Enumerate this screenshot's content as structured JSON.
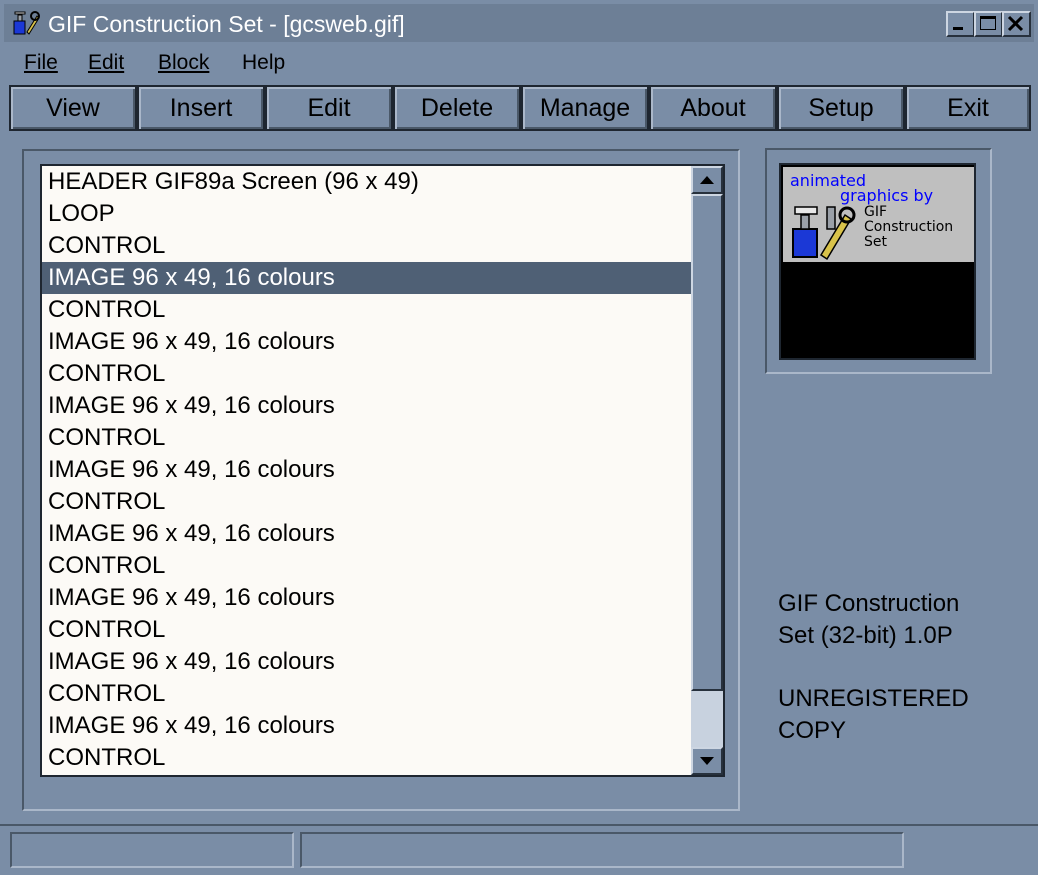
{
  "window": {
    "title": "GIF Construction Set - [gcsweb.gif]",
    "app_icon": "gif-construction-set-icon"
  },
  "menu": [
    {
      "label": "File"
    },
    {
      "label": "Edit"
    },
    {
      "label": "Block"
    },
    {
      "label": "Help"
    }
  ],
  "toolbar": [
    {
      "label": "View"
    },
    {
      "label": "Insert"
    },
    {
      "label": "Edit"
    },
    {
      "label": "Delete"
    },
    {
      "label": "Manage"
    },
    {
      "label": "About"
    },
    {
      "label": "Setup"
    },
    {
      "label": "Exit"
    }
  ],
  "blocks": [
    "HEADER GIF89a Screen (96 x 49)",
    "LOOP",
    "CONTROL",
    "IMAGE 96 x 49, 16 colours",
    "CONTROL",
    "IMAGE 96 x 49, 16 colours",
    "CONTROL",
    "IMAGE 96 x 49, 16 colours",
    "CONTROL",
    "IMAGE 96 x 49, 16 colours",
    "CONTROL",
    "IMAGE 96 x 49, 16 colours",
    "CONTROL",
    "IMAGE 96 x 49, 16 colours",
    "CONTROL",
    "IMAGE 96 x 49, 16 colours",
    "CONTROL",
    "IMAGE 96 x 49, 16 colours",
    "CONTROL"
  ],
  "selected_block_index": 3,
  "preview": {
    "line1": "animated",
    "line2": "graphics by",
    "line3": "GIF",
    "line4": "Construction",
    "line5": "Set"
  },
  "info": {
    "product_line1": "GIF Construction",
    "product_line2": "Set (32-bit) 1.0P",
    "license_line1": "UNREGISTERED",
    "license_line2": "COPY"
  },
  "colors": {
    "window_bg": "#7a8da6",
    "selection": "#4f6075",
    "list_bg": "#fcfaf6",
    "preview_text": "#0000ff"
  }
}
